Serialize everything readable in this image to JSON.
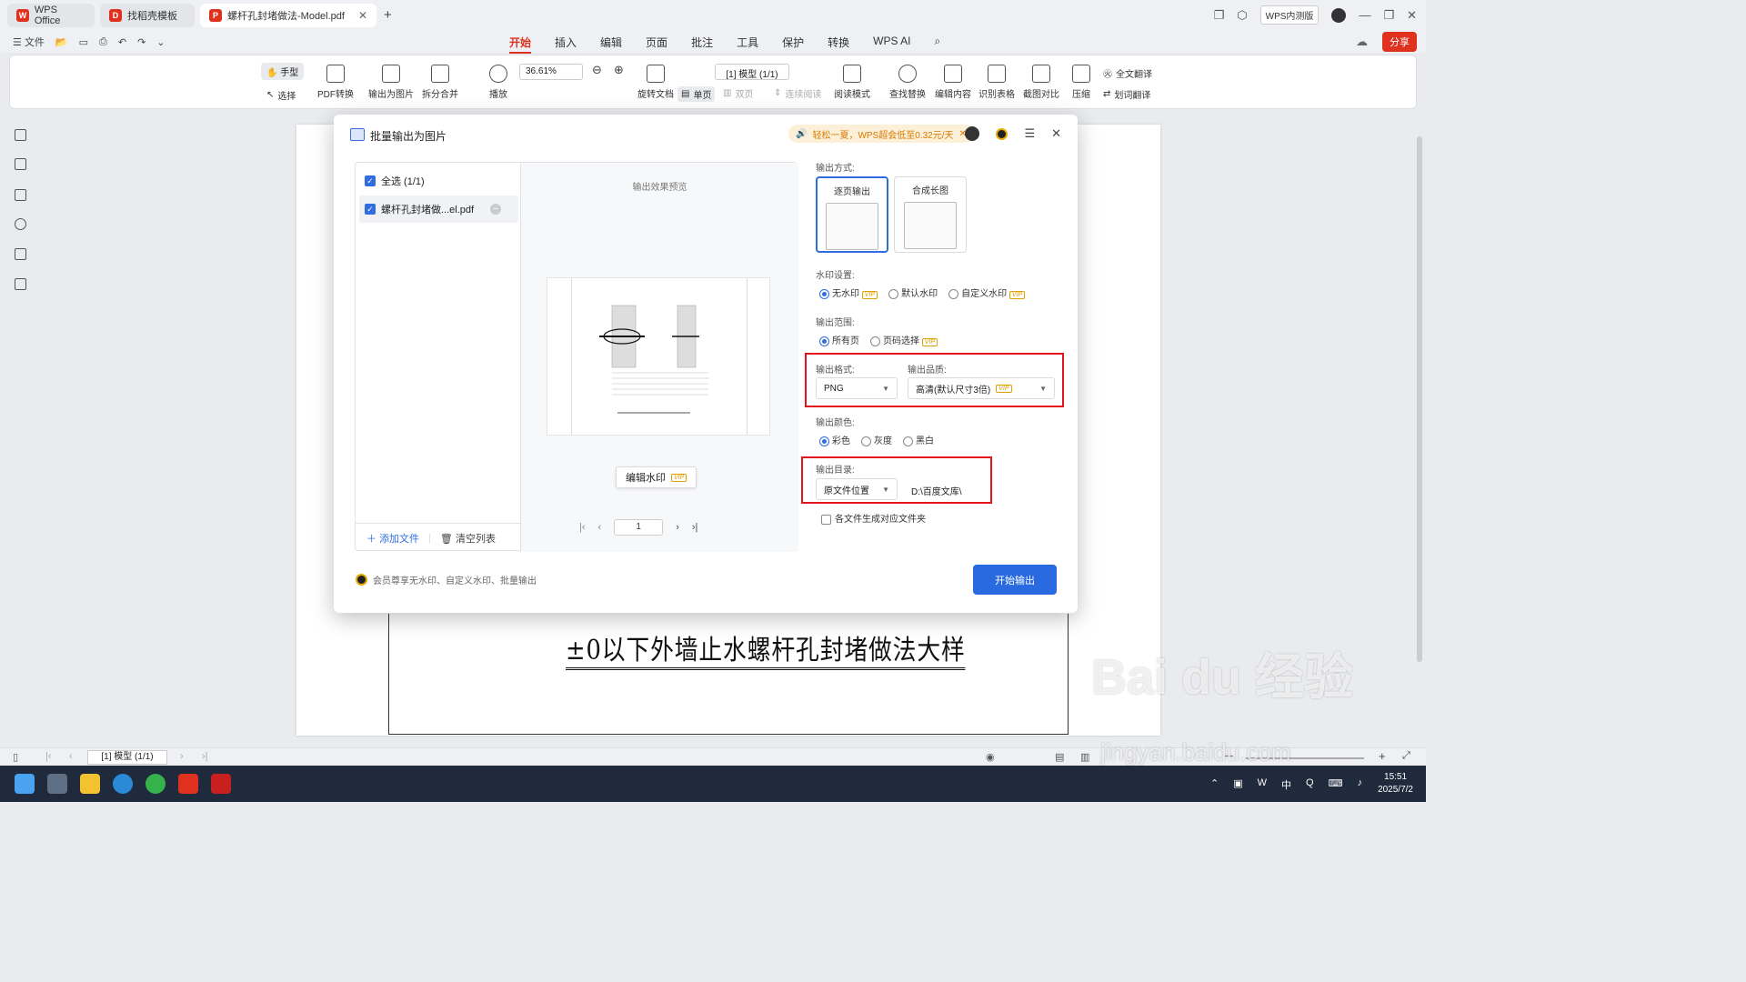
{
  "tabs": [
    {
      "label": "WPS Office"
    },
    {
      "label": "找稻壳模板"
    },
    {
      "label": "螺杆孔封堵做法-Model.pdf"
    }
  ],
  "titlebar": {
    "beta_label": "WPS内测版"
  },
  "menu": {
    "file": "文件",
    "items": [
      "开始",
      "插入",
      "编辑",
      "页面",
      "批注",
      "工具",
      "保护",
      "转换",
      "WPS AI"
    ],
    "share": "分享"
  },
  "ribbon": {
    "hand": "手型",
    "select": "选择",
    "pdf_convert": "PDF转换",
    "export_img": "输出为图片",
    "split_merge": "拆分合并",
    "play": "播放",
    "zoom": "36.61%",
    "rotate": "旋转文档",
    "single": "单页",
    "double": "双页",
    "continuous": "连续阅读",
    "read_mode": "阅读模式",
    "page_box": "[1] 模型 (1/1)",
    "find_replace": "查找替换",
    "edit_content": "编辑内容",
    "recognize_table": "识别表格",
    "screenshot_compare": "截图对比",
    "compress": "压缩",
    "full_translate": "全文翻译",
    "word_translate": "划词翻译"
  },
  "document": {
    "title": "±0以下外墙止水螺杆孔封堵做法大样"
  },
  "statusbar": {
    "page": "[1] 模型 (1/1)"
  },
  "taskbar": {
    "time": "15:51",
    "date": "2025/7/2",
    "ime": "中"
  },
  "dialog": {
    "title": "批量输出为图片",
    "promo": "轻松一夏，WPS超会低至0.32元/天",
    "select_all": "全选 (1/1)",
    "file_name": "螺杆孔封堵做...el.pdf",
    "add_file": "添加文件",
    "clear_list": "清空列表",
    "preview_title": "输出效果预览",
    "edit_watermark": "编辑水印",
    "vip": "VIP",
    "page_input": "1",
    "output_mode_label": "输出方式:",
    "mode_single": "逐页输出",
    "mode_long": "合成长图",
    "watermark_label": "水印设置:",
    "wm_none": "无水印",
    "wm_default": "默认水印",
    "wm_custom": "自定义水印",
    "range_label": "输出范围:",
    "range_all": "所有页",
    "range_select": "页码选择",
    "format_label": "输出格式:",
    "format_value": "PNG",
    "quality_label": "输出品质:",
    "quality_value": "高清(默认尺寸3倍)",
    "color_label": "输出颜色:",
    "color_color": "彩色",
    "color_gray": "灰度",
    "color_bw": "黑白",
    "dir_label": "输出目录:",
    "dir_value": "原文件位置",
    "dir_path": "D:\\百度文库\\",
    "per_folder": "各文件生成对应文件夹",
    "member_note": "会员尊享无水印、自定义水印、批量输出",
    "start": "开始输出"
  },
  "watermark": {
    "text1": "Bai du 经验",
    "text2": "jingyan.baidu.com"
  }
}
